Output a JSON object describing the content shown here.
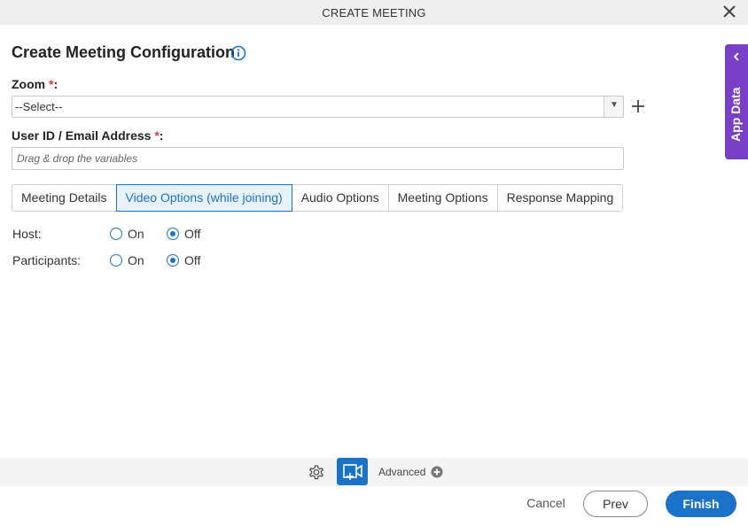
{
  "window": {
    "title": "CREATE MEETING",
    "close_icon": "close-icon"
  },
  "header": {
    "heading": "Create Meeting Configuration",
    "info_icon": "info-icon"
  },
  "form": {
    "zoom": {
      "label": "Zoom",
      "required_mark": "*",
      "colon": ":",
      "value": "--Select--"
    },
    "user_id": {
      "label": "User ID / Email Address",
      "required_mark": "*",
      "colon": ":",
      "placeholder": "Drag & drop the variables"
    }
  },
  "tabs": [
    {
      "label": "Meeting Details",
      "active": false
    },
    {
      "label": "Video Options (while joining)",
      "active": true
    },
    {
      "label": "Audio Options",
      "active": false
    },
    {
      "label": "Meeting Options",
      "active": false
    },
    {
      "label": "Response Mapping",
      "active": false
    }
  ],
  "video_options": {
    "host": {
      "label": "Host:",
      "on_label": "On",
      "off_label": "Off",
      "selected": "Off"
    },
    "participants": {
      "label": "Participants:",
      "on_label": "On",
      "off_label": "Off",
      "selected": "Off"
    }
  },
  "side_panel": {
    "label": "App Data"
  },
  "bottom_toolbar": {
    "advanced_label": "Advanced"
  },
  "footer": {
    "cancel_label": "Cancel",
    "prev_label": "Prev",
    "finish_label": "Finish"
  },
  "colors": {
    "accent": "#1a73c9",
    "side_panel": "#7a3fc7",
    "required": "#d33b3b"
  }
}
